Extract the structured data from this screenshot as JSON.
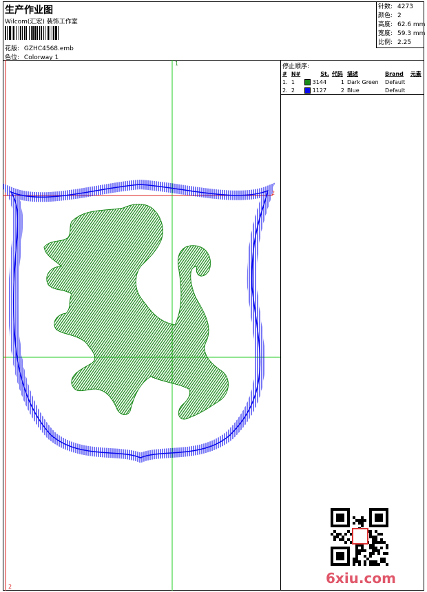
{
  "header": {
    "title": "生产作业图",
    "subtitle": "Wilcom(汇宏) 装饰工作室",
    "design_label": "花版:",
    "design_value": "GZHC4568.emb",
    "color_label": "色位:",
    "color_value": "Colorway 1"
  },
  "stats": {
    "stitches_label": "针数:",
    "stitches": "4273",
    "colors_label": "颜色:",
    "colors": "2",
    "height_label": "高度:",
    "height": "62.6 mm",
    "width_label": "宽度:",
    "width": "59.3 mm",
    "ratio_label": "比例:",
    "ratio": "2.25"
  },
  "stop_sequence": {
    "title": "停止顺序:",
    "columns": [
      "#",
      "N#",
      "St.",
      "代码",
      "描述",
      "Brand",
      "元素"
    ],
    "rows": [
      {
        "num": "1.",
        "n": "1",
        "color": "#1a8a1a",
        "stitches": "3144",
        "code": "1",
        "desc": "Dark Green",
        "brand": "Default",
        "element": ""
      },
      {
        "num": "2.",
        "n": "2",
        "color": "#0a0aee",
        "stitches": "1127",
        "code": "2",
        "desc": "Blue",
        "brand": "Default",
        "element": ""
      }
    ]
  },
  "canvas": {
    "guide_top": "1",
    "guide_right": "2",
    "guide_bottom": "2"
  },
  "colors": {
    "green": "#1a8a1a",
    "blue": "#0a0aee",
    "guide_green": "#22cc22",
    "guide_red": "#dd2222"
  },
  "watermark": "6xiu.com"
}
